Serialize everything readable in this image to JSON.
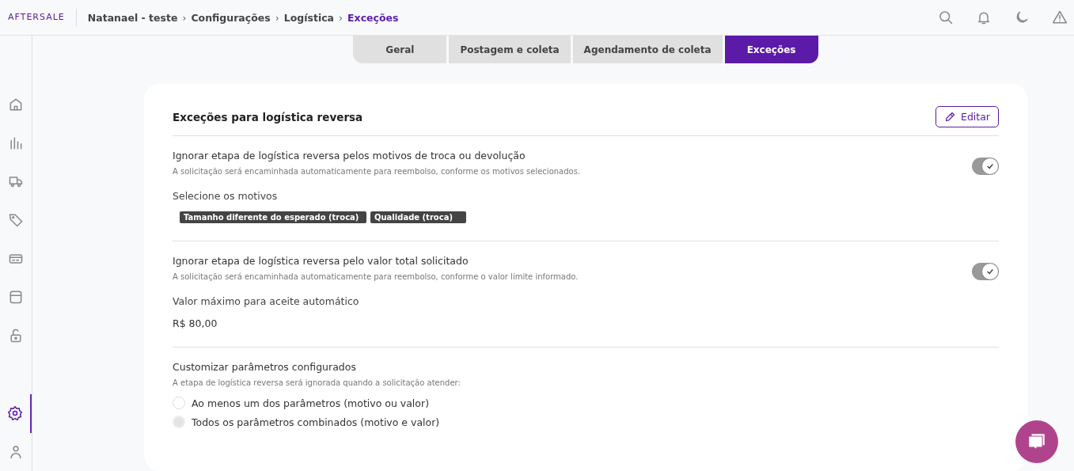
{
  "header": {
    "logo": "AFTERSALE",
    "breadcrumb": [
      {
        "label": "Natanael - teste",
        "current": false
      },
      {
        "label": "Configurações",
        "current": false
      },
      {
        "label": "Logística",
        "current": false
      },
      {
        "label": "Exceções",
        "current": true
      }
    ],
    "separator": "›"
  },
  "sidebar": {
    "items": [
      {
        "selected": false
      },
      {
        "selected": false
      },
      {
        "selected": false
      },
      {
        "selected": false
      },
      {
        "selected": false
      },
      {
        "selected": false
      },
      {
        "selected": false
      },
      {
        "selected": true
      },
      {
        "selected": false
      }
    ]
  },
  "tabs": [
    {
      "label": "Geral",
      "selected": false
    },
    {
      "label": "Postagem e coleta",
      "selected": false
    },
    {
      "label": "Agendamento de coleta",
      "selected": false
    },
    {
      "label": "Exceções",
      "selected": true
    }
  ],
  "card": {
    "title": "Exceções para logística reversa",
    "edit_button": "Editar",
    "sections": [
      {
        "kind": "reasons",
        "title": "Ignorar etapa de logística reversa pelos motivos de troca ou devolução",
        "description": "A solicitação será encaminhada automaticamente para reembolso, conforme os motivos selecionados.",
        "on": true,
        "field_label": "Selecione os motivos",
        "tags": [
          "Tamanho diferente do esperado (troca)",
          "Qualidade (troca)"
        ]
      },
      {
        "kind": "value",
        "title": "Ignorar etapa de logística reversa pelo valor total solicitado",
        "description": "A solicitação será encaminhada automaticamente para reembolso, conforme o valor limite informado.",
        "on": true,
        "field_label": "Valor máximo para aceite automático",
        "value": "R$ 80,00"
      },
      {
        "kind": "options",
        "title": "Customizar parâmetros configurados",
        "description": "A etapa de logística reversa será ignorada quando a solicitação atender:",
        "options": [
          {
            "label": "Ao menos um dos parâmetros (motivo ou valor)",
            "selected": false
          },
          {
            "label": "Todos os parâmetros combinados (motivo e valor)",
            "selected": true
          }
        ]
      }
    ]
  }
}
